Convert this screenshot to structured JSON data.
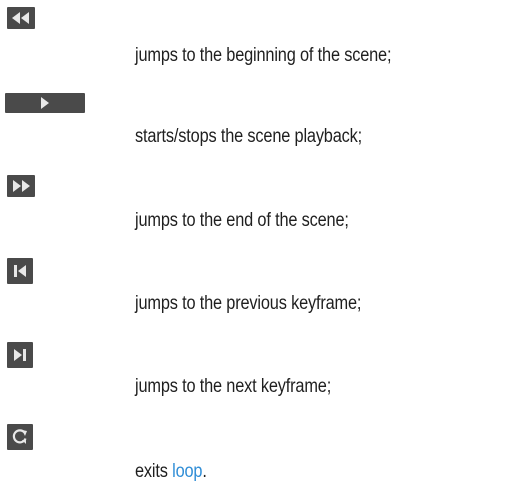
{
  "controls": [
    {
      "id": "rewind",
      "icon": "rewind-to-start-icon",
      "description": "jumps to the beginning of the scene;"
    },
    {
      "id": "play",
      "icon": "play-icon",
      "description": "starts/stops the scene playback;"
    },
    {
      "id": "fast-forward",
      "icon": "fast-forward-to-end-icon",
      "description": "jumps to the end of the scene;"
    },
    {
      "id": "prev-key",
      "icon": "previous-keyframe-icon",
      "description": "jumps to the previous keyframe;"
    },
    {
      "id": "next-key",
      "icon": "next-keyframe-icon",
      "description": "jumps to the next keyframe;"
    },
    {
      "id": "loop",
      "icon": "loop-icon",
      "description_prefix": "exits ",
      "description_link": "loop",
      "description_suffix": "."
    }
  ],
  "colors": {
    "button_bg": "#4a4a4a",
    "icon_fg": "#e8e8e8",
    "link": "#2f8dd6",
    "text": "#1f1f1f"
  }
}
